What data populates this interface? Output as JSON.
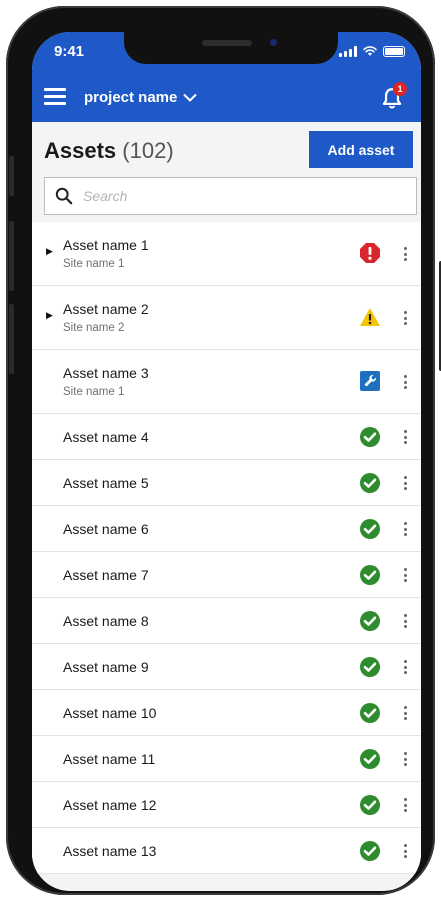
{
  "status_bar": {
    "time": "9:41"
  },
  "app_bar": {
    "project": "project name",
    "notification_count": "1"
  },
  "header": {
    "title": "Assets",
    "count": "(102)",
    "add_button": "Add asset"
  },
  "search": {
    "placeholder": "Search"
  },
  "assets": [
    {
      "name": "Asset name 1",
      "site": "Site name 1",
      "status": "alarm",
      "expandable": true
    },
    {
      "name": "Asset name 2",
      "site": "Site name 2",
      "status": "warning",
      "expandable": true
    },
    {
      "name": "Asset name 3",
      "site": "Site name 1",
      "status": "maintenance",
      "expandable": false
    },
    {
      "name": "Asset name 4",
      "status": "ok"
    },
    {
      "name": "Asset name 5",
      "status": "ok"
    },
    {
      "name": "Asset name 6",
      "status": "ok"
    },
    {
      "name": "Asset name 7",
      "status": "ok"
    },
    {
      "name": "Asset name 8",
      "status": "ok"
    },
    {
      "name": "Asset name 9",
      "status": "ok"
    },
    {
      "name": "Asset name 10",
      "status": "ok"
    },
    {
      "name": "Asset name 11",
      "status": "ok"
    },
    {
      "name": "Asset name 12",
      "status": "ok"
    },
    {
      "name": "Asset name 13",
      "status": "ok"
    }
  ],
  "colors": {
    "brand_blue": "#1f59c8",
    "alarm_red": "#d9262c",
    "warning_yellow": "#f5c400",
    "maintenance_blue": "#1f6fc0",
    "ok_green": "#2e8b2e"
  },
  "icons": {
    "alarm": "octagon-alert-icon",
    "warning": "triangle-warning-icon",
    "maintenance": "wrench-icon",
    "ok": "check-circle-icon"
  }
}
